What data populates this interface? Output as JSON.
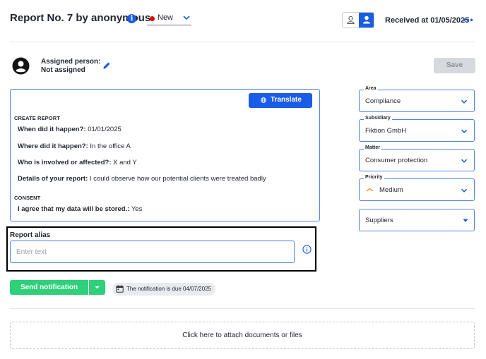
{
  "header": {
    "title": "Report No. 7 by anonymous",
    "info_icon": "info-icon",
    "status": {
      "label": "New",
      "color": "#e00000"
    },
    "received": "Received at 01/05/2025",
    "more_icon": "more-horizontal-icon"
  },
  "assigned": {
    "label": "Assigned person:",
    "value": "Not assigned",
    "avatar_icon": "user-avatar-icon",
    "edit_icon": "pencil-icon"
  },
  "save_label": "Save",
  "report": {
    "translate_label": "Translate",
    "sections": [
      {
        "title": "CREATE REPORT",
        "fields": [
          {
            "label": "When did it happen?:",
            "value": "01/01/2025"
          },
          {
            "label": "Where did it happen?:",
            "value": "In the office A"
          },
          {
            "label": "Who is involved or affected?:",
            "value": "X and Y"
          },
          {
            "label": "Details of your report:",
            "value": "I could observe how our potential clients were treated badly"
          }
        ]
      },
      {
        "title": "CONSENT",
        "fields": [
          {
            "label": "I agree that my data will be stored.:",
            "value": "Yes"
          }
        ]
      }
    ]
  },
  "alias": {
    "label": "Report alias",
    "placeholder": "Enter text",
    "value": ""
  },
  "notification": {
    "send_label": "Send notification",
    "due_text": "The notification is due 04/07/2025"
  },
  "attach_label": "Click here to attach documents or files",
  "sidebar": {
    "area": {
      "label": "Area",
      "value": "Compliance"
    },
    "subsidiary": {
      "label": "Subsidiary",
      "value": "Fiktion GmbH"
    },
    "matter": {
      "label": "Matter",
      "value": "Consumer protection"
    },
    "priority": {
      "label": "Priority",
      "value": "Medium",
      "color": "#f08a3e"
    },
    "suppliers": {
      "value": "Suppliers"
    }
  },
  "colors": {
    "primary": "#1a5ce6",
    "success": "#2fd07a",
    "border": "#4f83ee",
    "disabled": "#d6d9de"
  }
}
